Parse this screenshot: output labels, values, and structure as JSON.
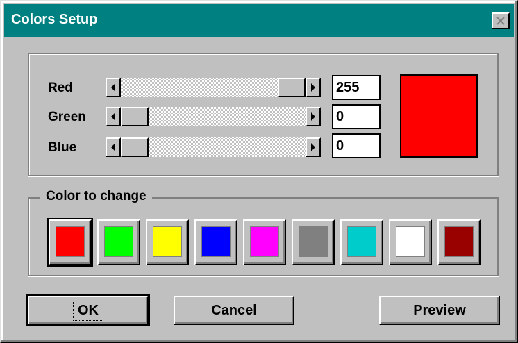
{
  "window": {
    "title": "Colors Setup"
  },
  "sliders": [
    {
      "label": "Red",
      "value": "255",
      "fraction": 1.0
    },
    {
      "label": "Green",
      "value": "0",
      "fraction": 0.0
    },
    {
      "label": "Blue",
      "value": "0",
      "fraction": 0.0
    }
  ],
  "preview_color": "#ff0000",
  "color_group": {
    "legend": "Color to change",
    "swatches": [
      "#ff0000",
      "#00ff00",
      "#ffff00",
      "#0000ff",
      "#ff00ff",
      "#808080",
      "#00cccc",
      "#ffffff",
      "#990000"
    ],
    "selected_index": 0
  },
  "buttons": {
    "ok": "OK",
    "cancel": "Cancel",
    "preview": "Preview"
  },
  "icons": {
    "close": "close-icon"
  }
}
